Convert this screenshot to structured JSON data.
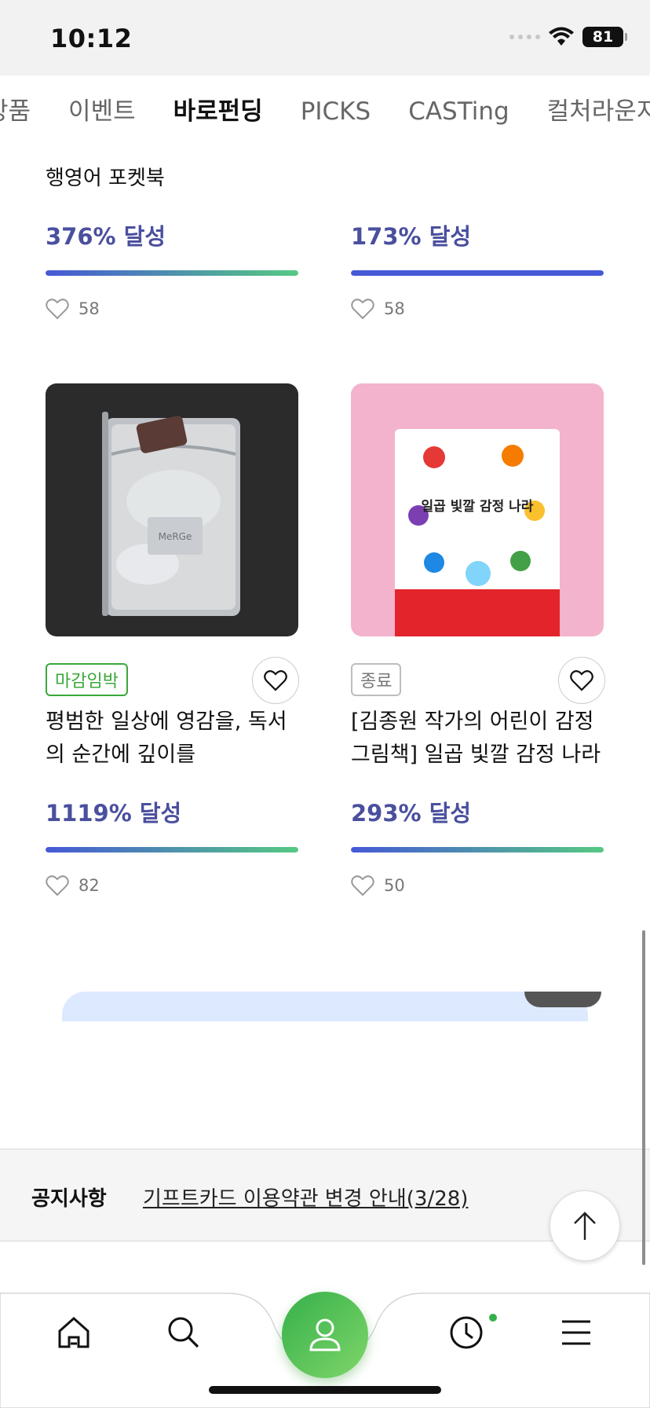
{
  "status_bar": {
    "time": "10:12",
    "battery": "81"
  },
  "tabs": [
    {
      "label": "상품"
    },
    {
      "label": "이벤트"
    },
    {
      "label": "바로펀딩"
    },
    {
      "label": "PICKS"
    },
    {
      "label": "CASTing"
    },
    {
      "label": "컬처라운지"
    }
  ],
  "products": [
    {
      "title_tail": "행영어 포켓북",
      "achievement": "376% 달성",
      "progress_percent": 100,
      "likes": "58"
    },
    {
      "achievement": "173% 달성",
      "progress_percent": 100,
      "likes": "58"
    },
    {
      "badge": "마감임박",
      "title": "평범한 일상에 영감을, 독서의 순간에 깊이를",
      "achievement": "1119% 달성",
      "progress_percent": 100,
      "likes": "82",
      "image_text": "MeRGe"
    },
    {
      "badge": "종료",
      "title": "[김종원 작가의 어린이 감정 그림책] 일곱 빛깔 감정 나라",
      "achievement": "293% 달성",
      "progress_percent": 100,
      "likes": "50",
      "cover_title": "일곱 빛깔 감정 나라"
    }
  ],
  "notice": {
    "label": "공지사항",
    "link": "기프트카드 이용약관 변경 안내(3/28)"
  },
  "bottom_nav": [
    {
      "icon": "home-icon"
    },
    {
      "icon": "search-icon"
    },
    {
      "icon": "user-icon"
    },
    {
      "icon": "clock-icon"
    },
    {
      "icon": "menu-icon"
    }
  ],
  "colors": {
    "accent_green": "#35b04a",
    "achievement_text": "#4a4f9e",
    "bar_start": "#4659d6",
    "bar_end": "#55c983"
  }
}
